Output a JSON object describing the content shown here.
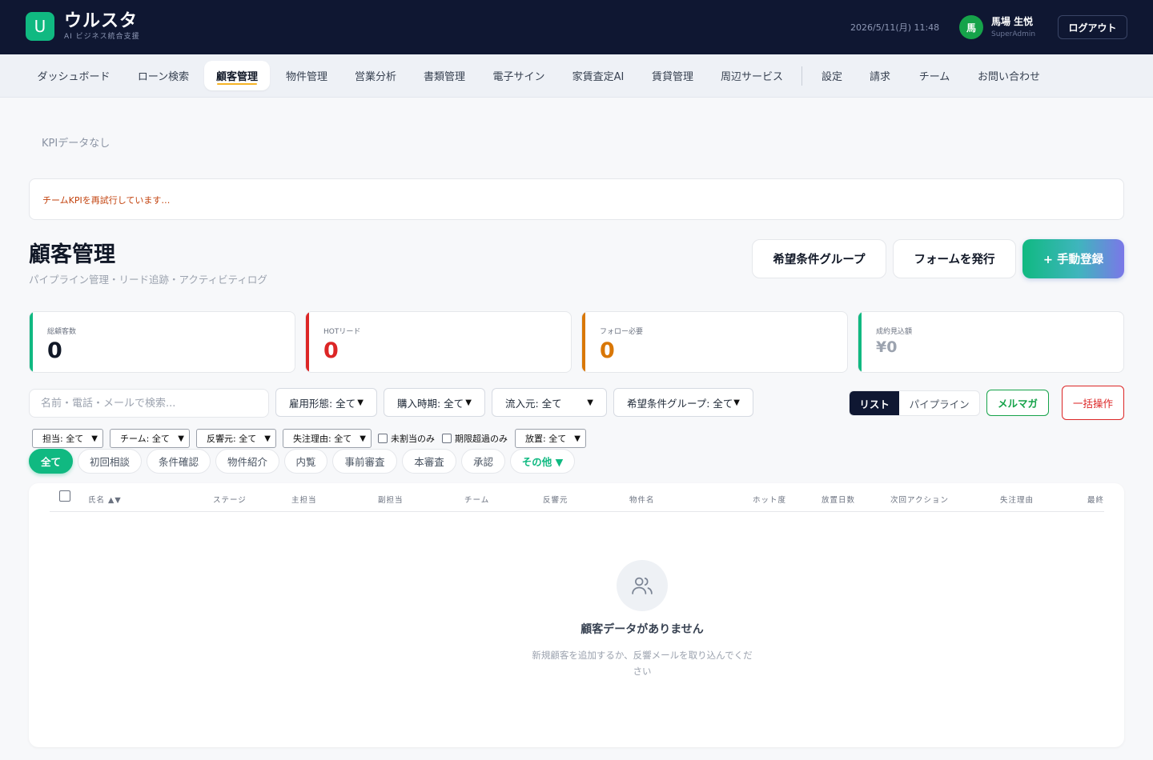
{
  "app": {
    "logo_letter": "U",
    "name": "ウルスタ",
    "tagline": "AI ビジネス統合支援",
    "brand_color": "#10b981"
  },
  "header": {
    "datetime": "2026/5/11(月) 11:48",
    "avatar_initial": "馬",
    "user_name": "馬場 生悦",
    "user_role": "SuperAdmin",
    "logout_label": "ログアウト"
  },
  "nav": {
    "items": [
      {
        "label": "ダッシュボード"
      },
      {
        "label": "ローン検索"
      },
      {
        "label": "顧客管理",
        "active": true
      },
      {
        "label": "物件管理"
      },
      {
        "label": "営業分析"
      },
      {
        "label": "書類管理"
      },
      {
        "label": "電子サイン"
      },
      {
        "label": "家賃査定AI"
      },
      {
        "label": "賃貸管理"
      },
      {
        "label": "周辺サービス"
      },
      {
        "label": "設定"
      },
      {
        "label": "請求"
      },
      {
        "label": "チーム"
      },
      {
        "label": "お問い合わせ"
      }
    ]
  },
  "kpi": {
    "empty_text": "KPIデータなし",
    "retry_text": "チームKPIを再試行しています…"
  },
  "page": {
    "title": "顧客管理",
    "subtitle": "パイプライン管理・リード追跡・アクティビティログ"
  },
  "actions": {
    "group_label": "希望条件グループ",
    "form_label": "フォームを発行",
    "add_label": "+ 手動登録"
  },
  "stats": [
    {
      "label": "総顧客数",
      "value": "0",
      "color": "#10b981",
      "value_color": "#111827"
    },
    {
      "label": "HOTリード",
      "value": "0",
      "color": "#dc2626",
      "value_color": "#dc2626"
    },
    {
      "label": "フォロー必要",
      "value": "0",
      "color": "#d97706",
      "value_color": "#d97706"
    },
    {
      "label": "成約見込額",
      "value": "¥0",
      "color": "#10b981",
      "value_color": "#9ca3af"
    }
  ],
  "filters": {
    "search_placeholder": "名前・電話・メールで検索...",
    "employment": "雇用形態: 全て",
    "purchase_time": "購入時期: 全て",
    "source": "流入元: 全て",
    "group": "希望条件グループ: 全て",
    "owner": "担当: 全て",
    "team": "チーム: 全て",
    "response_source": "反響元: 全て",
    "lost_reason": "失注理由: 全て",
    "unassigned": "未割当のみ",
    "overdue": "期限超過のみ",
    "neglect": "放置: 全て"
  },
  "view": {
    "list": "リスト",
    "pipeline": "パイプライン",
    "mailmag": "メルマガ",
    "bulk": "一括操作"
  },
  "stages": [
    {
      "label": "全て",
      "active": true
    },
    {
      "label": "初回相談"
    },
    {
      "label": "条件確認"
    },
    {
      "label": "物件紹介"
    },
    {
      "label": "内覧"
    },
    {
      "label": "事前審査"
    },
    {
      "label": "本審査"
    },
    {
      "label": "承認"
    },
    {
      "label": "その他 ▼",
      "more": true
    }
  ],
  "table": {
    "columns": [
      "氏名 ▲▼",
      "ステージ",
      "主担当",
      "副担当",
      "チーム",
      "反響元",
      "物件名",
      "ホット度",
      "放置日数",
      "次回アクション",
      "失注理由",
      "最終"
    ],
    "empty_title": "顧客データがありません",
    "empty_desc": "新規顧客を追加するか、反響メールを取り込んでください"
  }
}
